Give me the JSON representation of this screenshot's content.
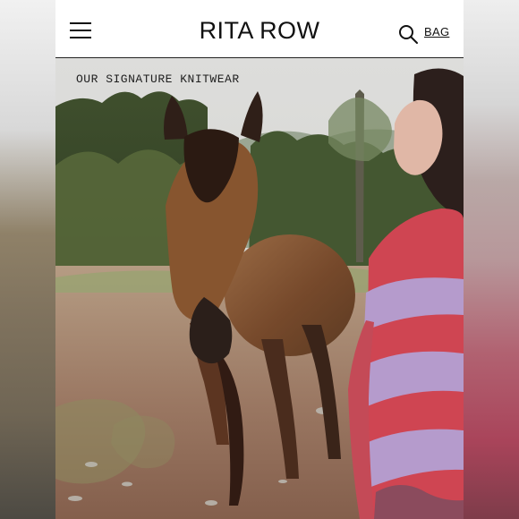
{
  "header": {
    "brand": "RITA ROW",
    "bag_label": "BAG",
    "menu_icon": "hamburger-menu-icon",
    "search_icon": "search-icon"
  },
  "hero": {
    "caption": "OUR SIGNATURE KNITWEAR",
    "image_description_colors": {
      "sky": "#d7d7d2",
      "forest": "#4b5a39",
      "ground": "#9c7a61",
      "horse": "#7b4f2e",
      "sweater_pink": "#d34a55",
      "sweater_lilac": "#b9a1cf"
    }
  },
  "colors": {
    "text": "#111111",
    "background": "#ffffff"
  }
}
